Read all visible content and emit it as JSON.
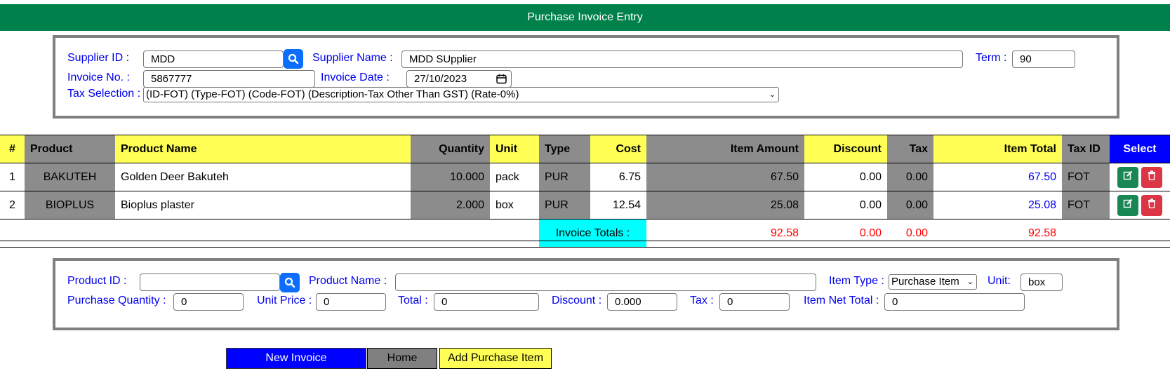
{
  "title": "Purchase Invoice Entry",
  "header": {
    "supplier_id_label": "Supplier ID :",
    "supplier_id_value": "MDD",
    "supplier_name_label": "Supplier Name :",
    "supplier_name_value": "MDD SUpplier",
    "term_label": "Term :",
    "term_value": "90",
    "invoice_no_label": "Invoice No. :",
    "invoice_no_value": "5867777",
    "invoice_date_label": "Invoice Date :",
    "invoice_date_value": "27/10/2023",
    "tax_label": "Tax Selection :",
    "tax_value": "(ID-FOT) (Type-FOT) (Code-FOT) (Description-Tax Other Than GST) (Rate-0%)"
  },
  "table": {
    "columns": [
      "#",
      "Product",
      "Product Name",
      "Quantity",
      "Unit",
      "Type",
      "Cost",
      "Item Amount",
      "Discount",
      "Tax",
      "Item Total",
      "Tax ID",
      "Select"
    ],
    "rows": [
      {
        "num": "1",
        "product": "BAKUTEH",
        "name": "Golden Deer Bakuteh",
        "qty": "10.000",
        "unit": "pack",
        "type": "PUR",
        "cost": "6.75",
        "amount": "67.50",
        "discount": "0.00",
        "tax": "0.00",
        "total": "67.50",
        "taxid": "FOT"
      },
      {
        "num": "2",
        "product": "BIOPLUS",
        "name": "Bioplus plaster",
        "qty": "2.000",
        "unit": "box",
        "type": "PUR",
        "cost": "12.54",
        "amount": "25.08",
        "discount": "0.00",
        "tax": "0.00",
        "total": "25.08",
        "taxid": "FOT"
      }
    ],
    "totals": {
      "label": "Invoice Totals :",
      "amount": "92.58",
      "discount": "0.00",
      "tax": "0.00",
      "total": "92.58"
    }
  },
  "item": {
    "product_id_label": "Product ID :",
    "product_id_value": "",
    "product_name_label": "Product Name :",
    "product_name_value": "",
    "item_type_label": "Item Type :",
    "item_type_value": "Purchase Item",
    "unit_label": "Unit:",
    "unit_value": "box",
    "qty_label": "Purchase Quantity :",
    "qty_value": "0",
    "unit_price_label": "Unit Price :",
    "unit_price_value": "0",
    "total_label": "Total :",
    "total_value": "0",
    "discount_label": "Discount :",
    "discount_value": "0.000",
    "tax_label": "Tax :",
    "tax_value": "0",
    "net_total_label": "Item Net Total :",
    "net_total_value": "0"
  },
  "buttons": {
    "new_invoice": "New Invoice",
    "home": "Home",
    "add_item": "Add Purchase Item"
  },
  "icons": {
    "search": "search-icon",
    "calendar": "calendar-icon",
    "edit": "edit-icon",
    "delete": "trash-icon",
    "dropdown": "chevron-down-icon"
  },
  "colors": {
    "title_bar": "#00804b",
    "label": "#0000ee",
    "header_yellow": "#ffff55",
    "header_gray": "#8c8c8c",
    "select_blue": "#0000ff",
    "total_red": "#ff0000",
    "totals_cyan": "#00ffff",
    "edit_green": "#198754",
    "delete_red": "#dc3545"
  }
}
